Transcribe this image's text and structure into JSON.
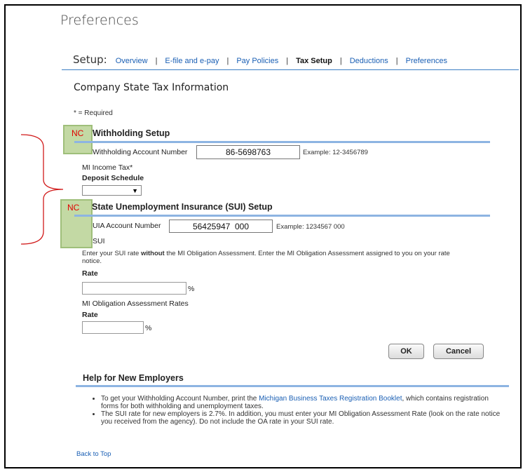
{
  "page": {
    "title": "Preferences"
  },
  "setup_nav": {
    "label": "Setup:",
    "items": [
      {
        "label": "Overview"
      },
      {
        "label": "E-file and e-pay"
      },
      {
        "label": "Pay Policies"
      },
      {
        "label": "Tax Setup"
      },
      {
        "label": "Deductions"
      },
      {
        "label": "Preferences"
      }
    ],
    "separator": "|",
    "active_item": "Tax Setup"
  },
  "section": {
    "title": "Company State Tax Information",
    "required_note": "* = Required"
  },
  "annotations": {
    "nc_label": "NC"
  },
  "withholding": {
    "heading": "Withholding Setup",
    "account_label": "Withholding Account Number",
    "account_value": "86-5698763",
    "account_example": "Example: 12-3456789",
    "income_tax_label": "MI Income Tax*",
    "deposit_schedule_label": "Deposit Schedule",
    "deposit_schedule_value": ""
  },
  "sui": {
    "heading": "State Unemployment Insurance (SUI) Setup",
    "uia_label": "UIA Account Number",
    "uia_value": "56425947  000",
    "uia_example": "Example: 1234567 000",
    "sui_label": "SUI",
    "instruction_before": "Enter your SUI rate ",
    "instruction_bold": "without",
    "instruction_after": " the MI Obligation Assessment. Enter the MI Obligation Assessment assigned to you on your rate notice.",
    "rate_label": "Rate",
    "rate_value": "",
    "percent": "%",
    "oa_label": "MI Obligation Assessment Rates",
    "oa_rate_label": "Rate",
    "oa_rate_value": ""
  },
  "buttons": {
    "ok": "OK",
    "cancel": "Cancel"
  },
  "help": {
    "heading": "Help for New Employers",
    "item1_before": "To get your Withholding Account Number, print the ",
    "item1_link": "Michigan Business Taxes Registration Booklet",
    "item1_after": ", which contains registration forms for both withholding and unemployment taxes.",
    "item2": "The SUI rate for new employers is 2.7%. In addition, you must enter your MI Obligation Assessment Rate (look on the rate notice you received from the agency). Do not include the OA rate in your SUI rate."
  },
  "footer": {
    "back_to_top": "Back to Top"
  },
  "colors": {
    "link": "#1a5fb4",
    "rule": "#8db4e2",
    "annotation_box": "#c3d9a4",
    "annotation_text": "#e00000",
    "bracket": "#d11a1a"
  }
}
